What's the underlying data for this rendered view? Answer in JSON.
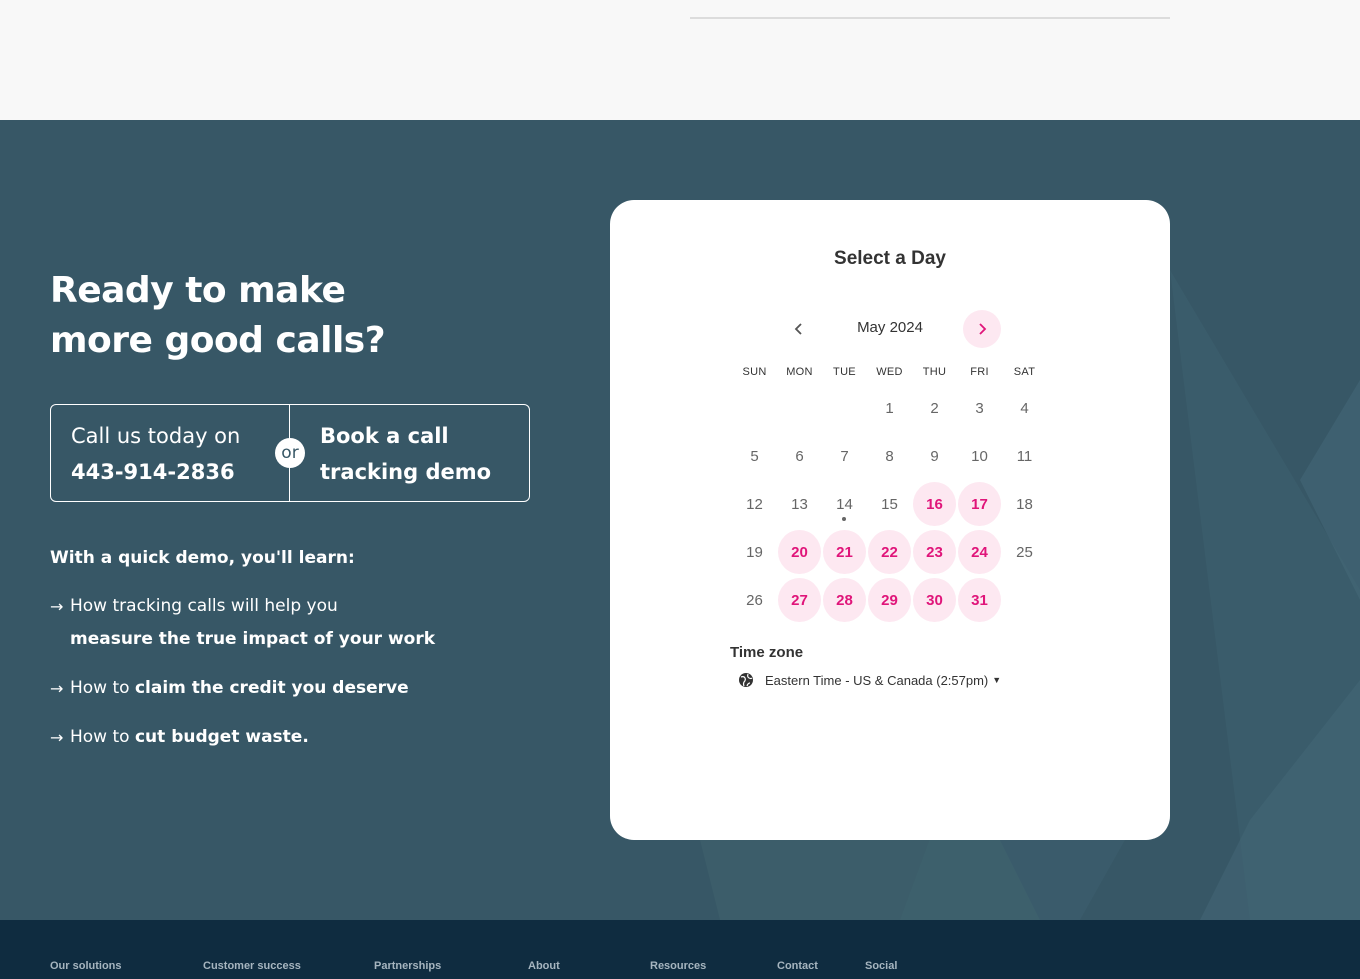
{
  "headline": {
    "line1": "Ready to make",
    "line2": "more good calls?"
  },
  "contact": {
    "call_text": "Call us today on",
    "phone": "443-914-2836",
    "or_label": "or",
    "demo_line1": "Book a call",
    "demo_line2": "tracking demo"
  },
  "learn": {
    "title": "With a quick demo, you'll learn:",
    "items": [
      {
        "plain": "How tracking calls will help you",
        "bold": "measure the true impact of your work"
      },
      {
        "plain": "How to ",
        "bold": "claim the credit you deserve"
      },
      {
        "plain": "How to ",
        "bold": "cut budget waste."
      }
    ]
  },
  "calendar": {
    "title": "Select a Day",
    "month": "May 2024",
    "weekdays": [
      "SUN",
      "MON",
      "TUE",
      "WED",
      "THU",
      "FRI",
      "SAT"
    ],
    "weeks": [
      [
        "",
        "",
        "",
        "1",
        "2",
        "3",
        "4"
      ],
      [
        "5",
        "6",
        "7",
        "8",
        "9",
        "10",
        "11"
      ],
      [
        "12",
        "13",
        "14",
        "15",
        "16",
        "17",
        "18"
      ],
      [
        "19",
        "20",
        "21",
        "22",
        "23",
        "24",
        "25"
      ],
      [
        "26",
        "27",
        "28",
        "29",
        "30",
        "31",
        ""
      ]
    ],
    "available_days": [
      "16",
      "17",
      "20",
      "21",
      "22",
      "23",
      "24",
      "27",
      "28",
      "29",
      "30",
      "31"
    ],
    "today": "14",
    "timezone_label": "Time zone",
    "timezone_value": "Eastern Time - US & Canada (2:57pm)",
    "accent_color": "#e0157a",
    "accent_bg": "#fde8f1"
  },
  "footer": {
    "links": [
      "Our solutions",
      "Customer success",
      "Partnerships",
      "About",
      "Resources",
      "Contact",
      "Social"
    ]
  },
  "colors": {
    "cta_bg": "#375766",
    "footer_bg": "#0f2c40",
    "page_bg": "#f8f8f8"
  }
}
